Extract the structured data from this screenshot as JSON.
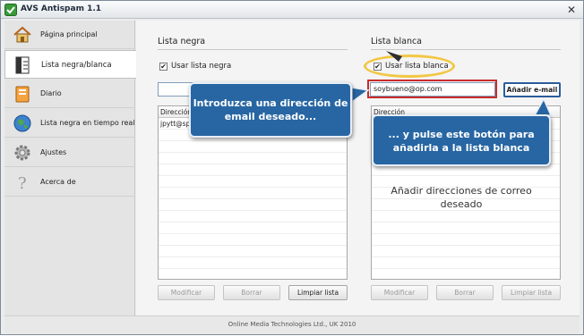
{
  "window": {
    "title": "AVS Antispam 1.1",
    "close_glyph": "✕"
  },
  "sidebar": {
    "items": [
      {
        "label": "Página principal",
        "icon": "home-icon"
      },
      {
        "label": "Lista negra/blanca",
        "icon": "list-icon"
      },
      {
        "label": "Diario",
        "icon": "log-icon"
      },
      {
        "label": "Lista negra en tiempo real",
        "icon": "globe-icon"
      },
      {
        "label": "Ajustes",
        "icon": "gear-icon"
      },
      {
        "label": "Acerca de",
        "icon": "help-icon"
      }
    ]
  },
  "blacklist": {
    "title": "Lista negra",
    "use_label": "Usar lista negra",
    "checked_glyph": "✔",
    "input_value": "",
    "column_header": "Dirección",
    "rows": [
      "jpytt@sp"
    ],
    "buttons": {
      "modify": "Modificar",
      "delete": "Borrar",
      "clear": "Limpiar lista"
    }
  },
  "whitelist": {
    "title": "Lista blanca",
    "use_label": "Usar lista blanca",
    "checked_glyph": "✔",
    "input_value": "soybueno@op.com",
    "add_button": "Añadir e-mail",
    "column_header": "Dirección",
    "rows": [],
    "buttons": {
      "modify": "Modificar",
      "delete": "Borrar",
      "clear": "Limpiar lista"
    }
  },
  "footer": {
    "text": "Online Media Technologies Ltd., UK 2010"
  },
  "annotations": {
    "callout_input": "Introduzca una dirección de email deseado...",
    "callout_button": "... y pulse este botón para añadirla a la lista blanca",
    "caption": "Añadir direcciones de correo deseado"
  },
  "colors": {
    "callout": "#2766a3",
    "highlight": "#f2c744",
    "add_border": "#2b5c9b"
  }
}
